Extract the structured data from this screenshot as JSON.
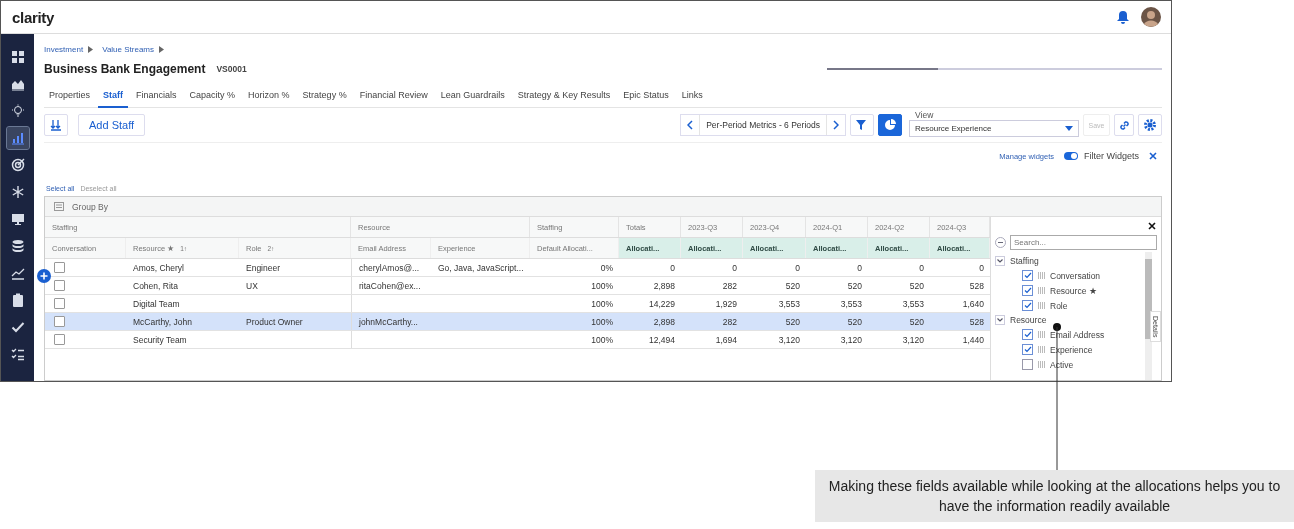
{
  "header": {
    "logo": "clarity"
  },
  "sidebar": {
    "items": [
      {
        "kind": "grid",
        "selected": false
      },
      {
        "kind": "area",
        "selected": false
      },
      {
        "kind": "bulb",
        "selected": false
      },
      {
        "kind": "bars",
        "selected": true
      },
      {
        "kind": "target",
        "selected": false
      },
      {
        "kind": "snowflake",
        "selected": false
      },
      {
        "kind": "monitor",
        "selected": false
      },
      {
        "kind": "database",
        "selected": false
      },
      {
        "kind": "trend",
        "selected": false
      },
      {
        "kind": "clipboard",
        "selected": false
      },
      {
        "kind": "check",
        "selected": false
      },
      {
        "kind": "checklist",
        "selected": false
      }
    ]
  },
  "breadcrumb": [
    "Investment",
    "Value Streams"
  ],
  "title": "Business Bank Engagement",
  "code": "VS0001",
  "progress": {
    "level": 0.33
  },
  "tabs": [
    {
      "label": "Properties",
      "selected": false
    },
    {
      "label": "Staff",
      "selected": true
    },
    {
      "label": "Financials",
      "selected": false
    },
    {
      "label": "Capacity %",
      "selected": false
    },
    {
      "label": "Horizon %",
      "selected": false
    },
    {
      "label": "Strategy %",
      "selected": false
    },
    {
      "label": "Financial Review",
      "selected": false
    },
    {
      "label": "Lean Guardrails",
      "selected": false
    },
    {
      "label": "Strategy & Key Results",
      "selected": false
    },
    {
      "label": "Epic Status",
      "selected": false
    },
    {
      "label": "Links",
      "selected": false
    }
  ],
  "toolbar": {
    "add_button": "Add Staff",
    "period": "Per-Period Metrics - 6 Periods",
    "view_label": "View",
    "view_value": "Resource Experience",
    "save": "Save"
  },
  "widgets": {
    "manage": "Manage widgets",
    "filter_label": "Filter Widgets",
    "filter_on": true
  },
  "select_all": "Select all",
  "deselect_all": "Deselect all",
  "grid": {
    "group_by": "Group By",
    "groups": [
      "Staffing",
      "Resource",
      "Staffing",
      "Totals",
      "2023-Q3",
      "2023-Q4",
      "2024-Q1",
      "2024-Q2",
      "2024-Q3"
    ],
    "columns": [
      {
        "label": "Conversation",
        "kind": "check"
      },
      {
        "label": "Resource ★",
        "sort": "1↑",
        "kind": "text"
      },
      {
        "label": "Role",
        "sort": "2↑",
        "kind": "text"
      },
      {
        "label": "Email Address",
        "kind": "text"
      },
      {
        "label": "Experience",
        "kind": "text"
      },
      {
        "label": "Default Allocati...",
        "kind": "num"
      },
      {
        "label": "Allocati...",
        "kind": "metric"
      },
      {
        "label": "Allocati...",
        "kind": "metric"
      },
      {
        "label": "Allocati...",
        "kind": "metric"
      },
      {
        "label": "Allocati...",
        "kind": "metric"
      },
      {
        "label": "Allocati...",
        "kind": "metric"
      },
      {
        "label": "Allocati...",
        "kind": "metric"
      }
    ],
    "rows": [
      {
        "checked": false,
        "selected": false,
        "cells": [
          "",
          "Amos, Cheryl",
          "Engineer",
          "cherylAmos@...",
          "Go, Java, JavaScript...",
          "0%",
          "0",
          "0",
          "0",
          "0",
          "0",
          "0"
        ]
      },
      {
        "checked": false,
        "selected": false,
        "cells": [
          "",
          "Cohen, Rita",
          "UX",
          "ritaCohen@ex...",
          "",
          "100%",
          "2,898",
          "282",
          "520",
          "520",
          "520",
          "528"
        ]
      },
      {
        "checked": false,
        "selected": false,
        "cells": [
          "",
          "Digital Team",
          "",
          "",
          "",
          "100%",
          "14,229",
          "1,929",
          "3,553",
          "3,553",
          "3,553",
          "1,640"
        ]
      },
      {
        "checked": false,
        "selected": true,
        "cells": [
          "",
          "McCarthy, John",
          "Product Owner",
          "johnMcCarthy...",
          "",
          "100%",
          "2,898",
          "282",
          "520",
          "520",
          "520",
          "528"
        ]
      },
      {
        "checked": false,
        "selected": false,
        "cells": [
          "",
          "Security Team",
          "",
          "",
          "",
          "100%",
          "12,494",
          "1,694",
          "3,120",
          "3,120",
          "3,120",
          "1,440"
        ]
      }
    ]
  },
  "panel": {
    "search_placeholder": "Search...",
    "details_tab": "Details",
    "groups": [
      {
        "label": "Staffing",
        "expanded": true,
        "children": [
          {
            "label": "Conversation",
            "checked": true
          },
          {
            "label": "Resource ★",
            "checked": true
          },
          {
            "label": "Role",
            "checked": true
          }
        ]
      },
      {
        "label": "Resource",
        "expanded": true,
        "children": [
          {
            "label": "Email Address",
            "checked": true
          },
          {
            "label": "Experience",
            "checked": true
          },
          {
            "label": "Active",
            "checked": false
          }
        ]
      }
    ]
  },
  "callout": "Making these fields available while looking at the allocations helps you to have the information readily available"
}
